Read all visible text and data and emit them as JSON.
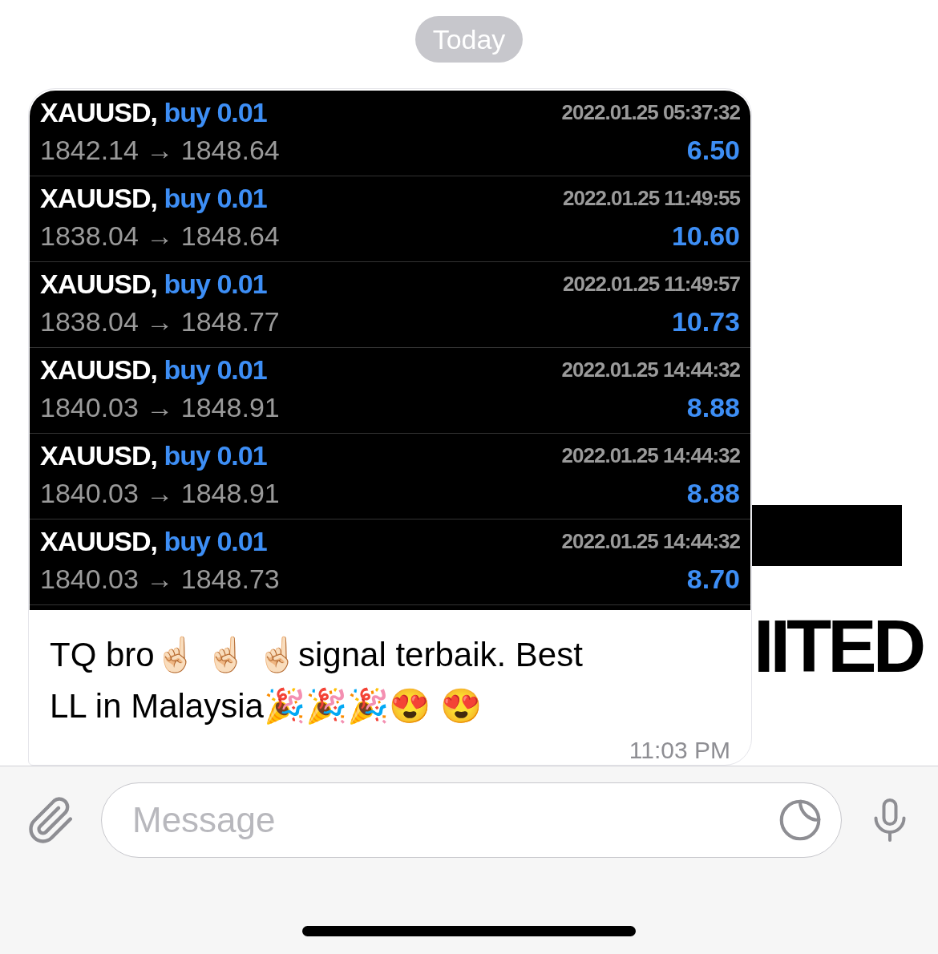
{
  "date_divider": "Today",
  "message": {
    "trades": [
      {
        "symbol": "XAUUSD,",
        "side": "buy 0.01",
        "prices": "1842.14 → 1848.64",
        "time": "2022.01.25 05:37:32",
        "profit": "6.50"
      },
      {
        "symbol": "XAUUSD,",
        "side": "buy 0.01",
        "prices": "1838.04 → 1848.64",
        "time": "2022.01.25 11:49:55",
        "profit": "10.60"
      },
      {
        "symbol": "XAUUSD,",
        "side": "buy 0.01",
        "prices": "1838.04 → 1848.77",
        "time": "2022.01.25 11:49:57",
        "profit": "10.73"
      },
      {
        "symbol": "XAUUSD,",
        "side": "buy 0.01",
        "prices": "1840.03 → 1848.91",
        "time": "2022.01.25 14:44:32",
        "profit": "8.88"
      },
      {
        "symbol": "XAUUSD,",
        "side": "buy 0.01",
        "prices": "1840.03 → 1848.91",
        "time": "2022.01.25 14:44:32",
        "profit": "8.88"
      },
      {
        "symbol": "XAUUSD,",
        "side": "buy 0.01",
        "prices": "1840.03 → 1848.73",
        "time": "2022.01.25 14:44:32",
        "profit": "8.70"
      }
    ],
    "text": "TQ bro☝🏻 ☝🏻 ☝🏻signal terbaik. Best LL in Malaysia🎉🎉🎉😍 😍",
    "time": "11:03 PM"
  },
  "background_text": "IITED",
  "composer": {
    "placeholder": "Message"
  }
}
